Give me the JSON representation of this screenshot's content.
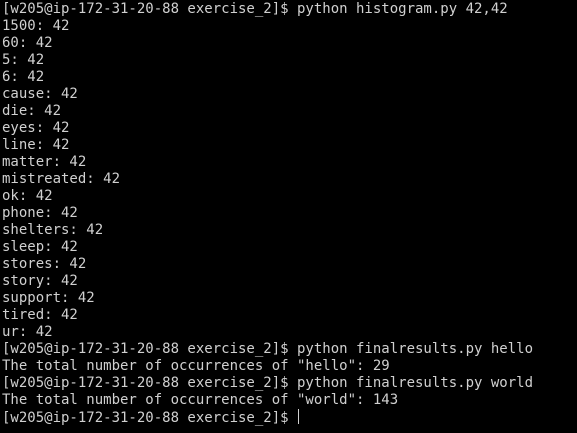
{
  "terminal": {
    "lines": [
      "[w205@ip-172-31-20-88 exercise_2]$ python histogram.py 42,42",
      "1500: 42",
      "60: 42",
      "5: 42",
      "6: 42",
      "cause: 42",
      "die: 42",
      "eyes: 42",
      "line: 42",
      "matter: 42",
      "mistreated: 42",
      "ok: 42",
      "phone: 42",
      "shelters: 42",
      "sleep: 42",
      "stores: 42",
      "story: 42",
      "support: 42",
      "tired: 42",
      "ur: 42",
      "[w205@ip-172-31-20-88 exercise_2]$ python finalresults.py hello",
      "The total number of occurrences of \"hello\": 29",
      "[w205@ip-172-31-20-88 exercise_2]$ python finalresults.py world",
      "The total number of occurrences of \"world\": 143"
    ],
    "prompt": "[w205@ip-172-31-20-88 exercise_2]$ "
  },
  "colors": {
    "background": "#000000",
    "foreground": "#d0d0d0"
  }
}
